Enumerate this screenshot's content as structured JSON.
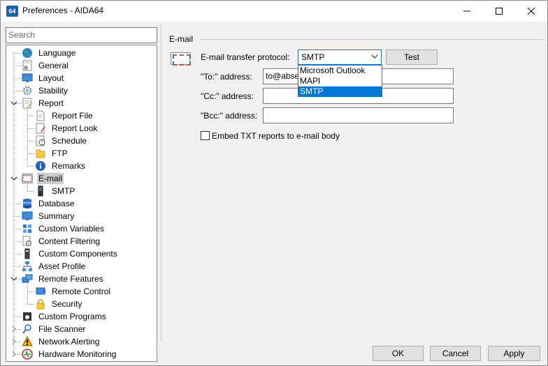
{
  "window": {
    "app_icon_text": "64",
    "title": "Preferences - AIDA64",
    "controls": {
      "minimize": "–",
      "maximize": "☐",
      "close": "✕"
    }
  },
  "search": {
    "placeholder": "Search"
  },
  "tree": [
    {
      "label": "Language",
      "icon": "globe-icon",
      "level": 0
    },
    {
      "label": "General",
      "icon": "general-settings-icon",
      "level": 0
    },
    {
      "label": "Layout",
      "icon": "monitor-icon",
      "level": 0
    },
    {
      "label": "Stability",
      "icon": "gear-icon",
      "level": 0
    },
    {
      "label": "Report",
      "icon": "report-icon",
      "level": 0,
      "expanded": true
    },
    {
      "label": "Report File",
      "icon": "document-icon",
      "level": 1
    },
    {
      "label": "Report Look",
      "icon": "report-look-icon",
      "level": 1
    },
    {
      "label": "Schedule",
      "icon": "schedule-icon",
      "level": 1
    },
    {
      "label": "FTP",
      "icon": "folder-icon",
      "level": 1
    },
    {
      "label": "Remarks",
      "icon": "info-icon",
      "level": 1
    },
    {
      "label": "E-mail",
      "icon": "email-icon",
      "level": 0,
      "expanded": true,
      "selected": true
    },
    {
      "label": "SMTP",
      "icon": "server-icon",
      "level": 1
    },
    {
      "label": "Database",
      "icon": "database-icon",
      "level": 0
    },
    {
      "label": "Summary",
      "icon": "summary-icon",
      "level": 0
    },
    {
      "label": "Custom Variables",
      "icon": "variables-icon",
      "level": 0
    },
    {
      "label": "Content Filtering",
      "icon": "filter-icon",
      "level": 0
    },
    {
      "label": "Custom Components",
      "icon": "component-icon",
      "level": 0
    },
    {
      "label": "Asset Profile",
      "icon": "network-icon",
      "level": 0
    },
    {
      "label": "Remote Features",
      "icon": "remote-icon",
      "level": 0,
      "expanded": true
    },
    {
      "label": "Remote Control",
      "icon": "remote-control-icon",
      "level": 1
    },
    {
      "label": "Security",
      "icon": "lock-icon",
      "level": 1
    },
    {
      "label": "Custom Programs",
      "icon": "program-icon",
      "level": 0
    },
    {
      "label": "File Scanner",
      "icon": "magnifier-icon",
      "level": 0,
      "collapsed": true
    },
    {
      "label": "Network Alerting",
      "icon": "warning-icon",
      "level": 0,
      "collapsed": true
    },
    {
      "label": "Hardware Monitoring",
      "icon": "hardware-monitor-icon",
      "level": 0,
      "collapsed": true
    }
  ],
  "email": {
    "group_label": "E-mail",
    "protocol_label": "E-mail transfer protocol:",
    "protocol_value": "SMTP",
    "protocol_options": [
      "Microsoft Outlook",
      "MAPI",
      "SMTP"
    ],
    "protocol_selected_index": 2,
    "test_button": "Test",
    "to_label": "\"To:\" address:",
    "to_value": "to@abse",
    "cc_label": "\"Cc:\" address:",
    "cc_value": "",
    "bcc_label": "\"Bcc:\" address:",
    "bcc_value": "",
    "embed_label": "Embed TXT reports to e-mail body",
    "embed_checked": false
  },
  "buttons": {
    "ok": "OK",
    "cancel": "Cancel",
    "apply": "Apply"
  },
  "colors": {
    "accent": "#0078d7",
    "selection_gray": "#cccccc"
  }
}
